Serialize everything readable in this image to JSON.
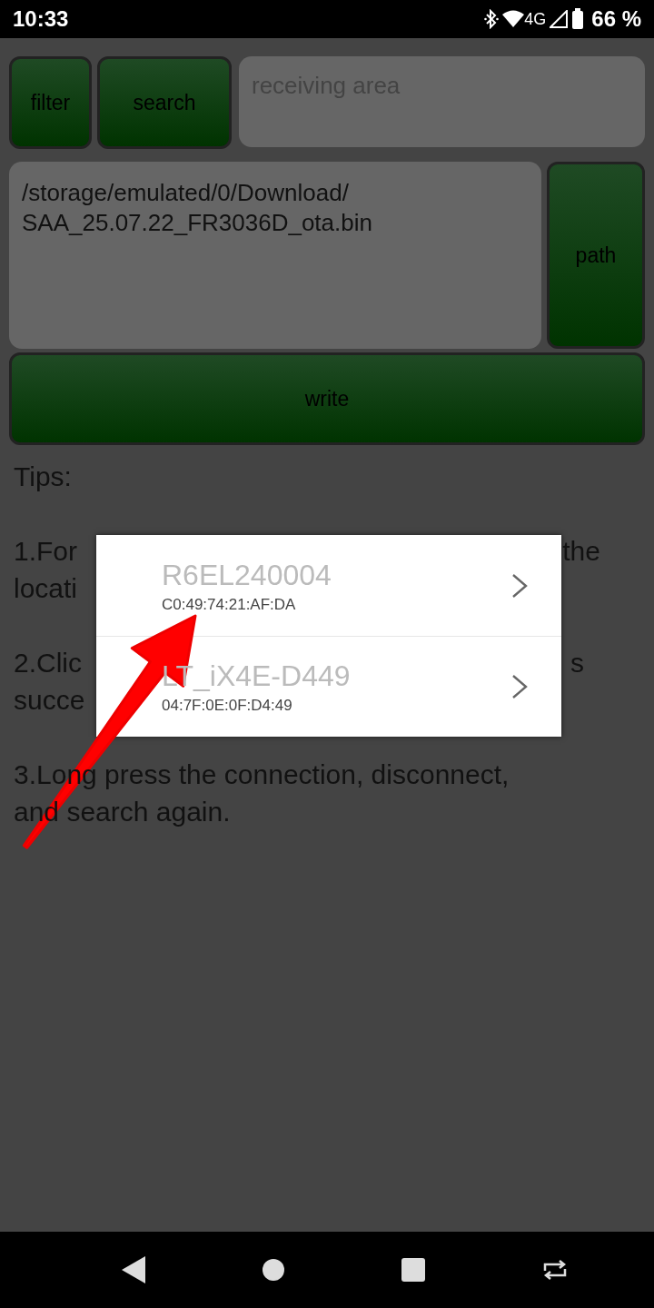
{
  "status_bar": {
    "time": "10:33",
    "network": "4G",
    "battery": "66 %"
  },
  "filter_button": "filter",
  "search_button": "search",
  "receive_field": {
    "placeholder": "receiving area"
  },
  "path_field": {
    "value": "/storage/emulated/0/Download/\nSAA_25.07.22_FR3036D_ota.bin"
  },
  "path_button": "path",
  "write_button": "write",
  "tips": {
    "title": "Tips:",
    "paragraphs": [
      {
        "lines": [
          {
            "left": "1.For",
            "right": "the"
          },
          {
            "left": "locati"
          }
        ]
      },
      {
        "lines": [
          {
            "left": "2.Clic",
            "right": "s"
          },
          {
            "left": "succe"
          }
        ]
      },
      {
        "text": "3.Long press the connection, disconnect, and search again."
      }
    ]
  },
  "device_list": [
    {
      "name": "R6EL240004",
      "address": "C0:49:74:21:AF:DA"
    },
    {
      "name": "LT_iX4E-D449",
      "address": "04:7F:0E:0F:D4:49"
    }
  ]
}
